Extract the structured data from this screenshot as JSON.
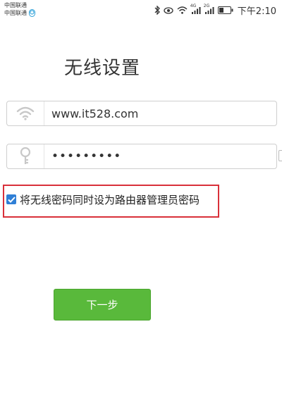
{
  "status_bar": {
    "carrier_1": "中国联通",
    "carrier_2": "中国联通",
    "network_type_1": "4G",
    "network_type_2": "2G",
    "time": "下午2:10"
  },
  "page": {
    "title": "无线设置"
  },
  "form": {
    "ssid_value": "www.it528.com",
    "password_value": "•••••••••",
    "sync_admin_checkbox_label": "将无线密码同时设为路由器管理员密码",
    "sync_admin_checked": true,
    "next_button_label": "下一步"
  },
  "colors": {
    "button_green": "#59b93b",
    "checkbox_blue": "#2f7fd6",
    "highlight_red": "#d9303a"
  },
  "icons": {
    "ssid_field": "wifi-icon",
    "password_field": "key-icon"
  }
}
